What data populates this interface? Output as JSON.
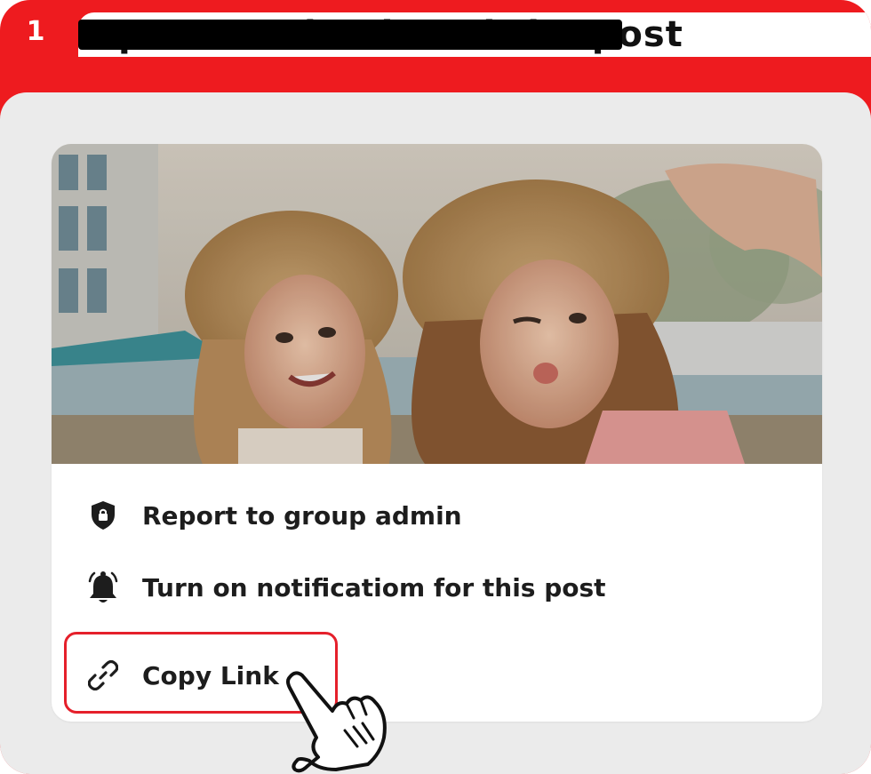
{
  "step": {
    "number": "1",
    "title": "Open Facebook and the post"
  },
  "menu": {
    "items": [
      {
        "label": "Report to group admin",
        "icon": "shield-lock-icon"
      },
      {
        "label": "Turn on notificatiom for this post",
        "icon": "bell-icon"
      },
      {
        "label": "Copy Link",
        "icon": "link-icon"
      }
    ]
  },
  "colors": {
    "accent": "#ee1b1f",
    "panel": "#ebebeb",
    "highlight": "#e5202b"
  },
  "pointer": {
    "icon": "hand-pointer-icon"
  }
}
